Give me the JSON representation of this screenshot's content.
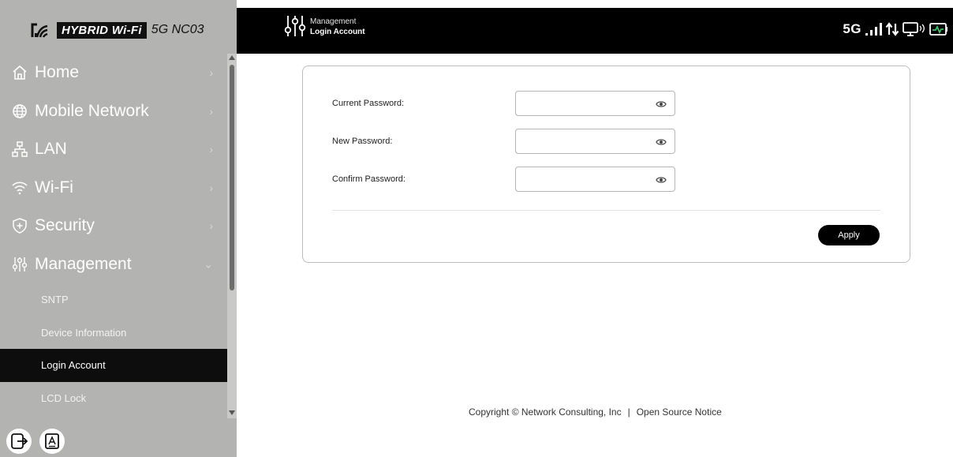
{
  "brand": {
    "hybrid": "HYBRID Wi-Fi",
    "model": "5G NC03"
  },
  "header": {
    "crumb_parent": "Management",
    "crumb_current": "Login Account",
    "network": "5G"
  },
  "nav": {
    "items": [
      {
        "label": "Home",
        "icon": "home-icon",
        "chevron": "›"
      },
      {
        "label": "Mobile Network",
        "icon": "globe-icon",
        "chevron": "›"
      },
      {
        "label": "LAN",
        "icon": "network-icon",
        "chevron": "›"
      },
      {
        "label": "Wi-Fi",
        "icon": "wifi-icon",
        "chevron": "›"
      },
      {
        "label": "Security",
        "icon": "shield-icon",
        "chevron": "›"
      },
      {
        "label": "Management",
        "icon": "sliders-icon",
        "chevron": "⌄"
      }
    ],
    "sub_items": [
      {
        "label": "SNTP"
      },
      {
        "label": "Device Information"
      },
      {
        "label": "Login Account",
        "active": true
      },
      {
        "label": "LCD Lock"
      }
    ]
  },
  "form": {
    "current_label": "Current Password:",
    "current_value": "",
    "new_label": "New Password:",
    "new_value": "",
    "confirm_label": "Confirm Password:",
    "confirm_value": "",
    "apply_label": "Apply"
  },
  "footer": {
    "copyright": "Copyright © Network Consulting, Inc",
    "separator": "|",
    "open_source": "Open Source Notice"
  },
  "colors": {
    "sidebar_bg": "#b3b3b2",
    "header_bg": "#000000",
    "active_item_bg": "#0d0d0d",
    "battery_accent": "#3cc36a"
  }
}
